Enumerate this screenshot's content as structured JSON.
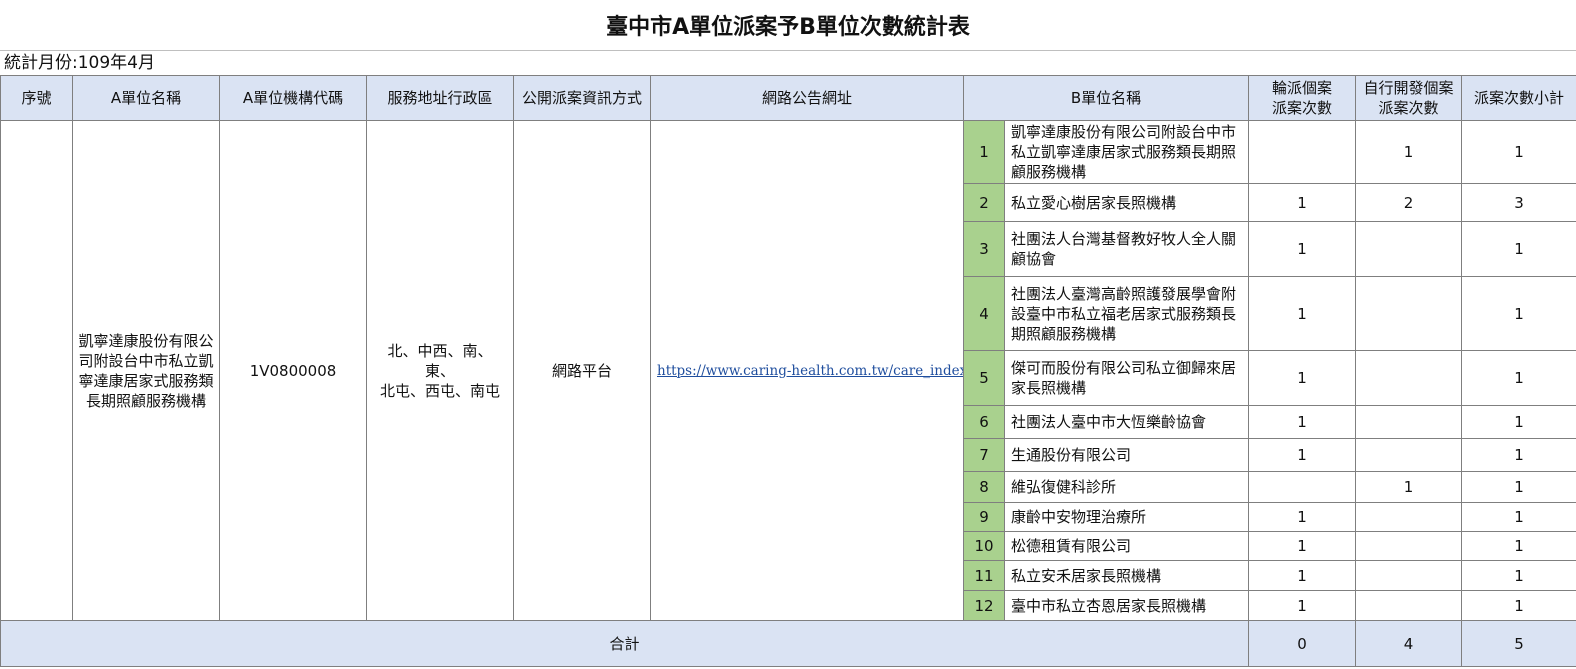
{
  "title": "臺中市A單位派案予B單位次數統計表",
  "month_label": "統計月份:109年4月",
  "headers": {
    "seq": "序號",
    "a_name": "A單位名稱",
    "a_code": "A單位機構代碼",
    "district": "服務地址行政區",
    "method": "公開派案資訊方式",
    "url": "網路公告網址",
    "b_name": "B單位名稱",
    "rotation_line1": "輪派個案",
    "rotation_line2": "派案次數",
    "self_line1": "自行開發個案",
    "self_line2": "派案次數",
    "subtotal": "派案次數小計"
  },
  "a_unit": {
    "name": "凱寧達康股份有限公司附設台中市私立凱寧達康居家式服務類長期照顧服務機構",
    "code": "1V0800008",
    "district_line1": "北、中西、南、",
    "district_line2": "東、",
    "district_line3": "北屯、西屯、南屯",
    "method": "網路平台",
    "url": "https://www.caring-health.com.tw/care_index"
  },
  "rows": [
    {
      "no": "1",
      "name": "凱寧達康股份有限公司附設台中市私立凱寧達康居家式服務類長期照顧服務機構",
      "rotation": "",
      "self": "1",
      "subtotal": "1"
    },
    {
      "no": "2",
      "name": "私立愛心樹居家長照機構",
      "rotation": "1",
      "self": "2",
      "subtotal": "3"
    },
    {
      "no": "3",
      "name": "社團法人台灣基督教好牧人全人關顧協會",
      "rotation": "1",
      "self": "",
      "subtotal": "1"
    },
    {
      "no": "4",
      "name": "社團法人臺灣高齡照護發展學會附設臺中市私立福老居家式服務類長期照顧服務機構",
      "rotation": "1",
      "self": "",
      "subtotal": "1"
    },
    {
      "no": "5",
      "name": "傑可而股份有限公司私立御歸來居家長照機構",
      "rotation": "1",
      "self": "",
      "subtotal": "1"
    },
    {
      "no": "6",
      "name": "社團法人臺中市大恆樂齡協會",
      "rotation": "1",
      "self": "",
      "subtotal": "1"
    },
    {
      "no": "7",
      "name": "生通股份有限公司",
      "rotation": "1",
      "self": "",
      "subtotal": "1"
    },
    {
      "no": "8",
      "name": "維弘復健科診所",
      "rotation": "",
      "self": "1",
      "subtotal": "1"
    },
    {
      "no": "9",
      "name": "康齡中安物理治療所",
      "rotation": "1",
      "self": "",
      "subtotal": "1"
    },
    {
      "no": "10",
      "name": "松德租賃有限公司",
      "rotation": "1",
      "self": "",
      "subtotal": "1"
    },
    {
      "no": "11",
      "name": "私立安禾居家長照機構",
      "rotation": "1",
      "self": "",
      "subtotal": "1"
    },
    {
      "no": "12",
      "name": "臺中市私立杏恩居家長照機構",
      "rotation": "1",
      "self": "",
      "subtotal": "1"
    }
  ],
  "total": {
    "label": "合計",
    "rotation": "0",
    "self": "4",
    "subtotal": "5"
  }
}
